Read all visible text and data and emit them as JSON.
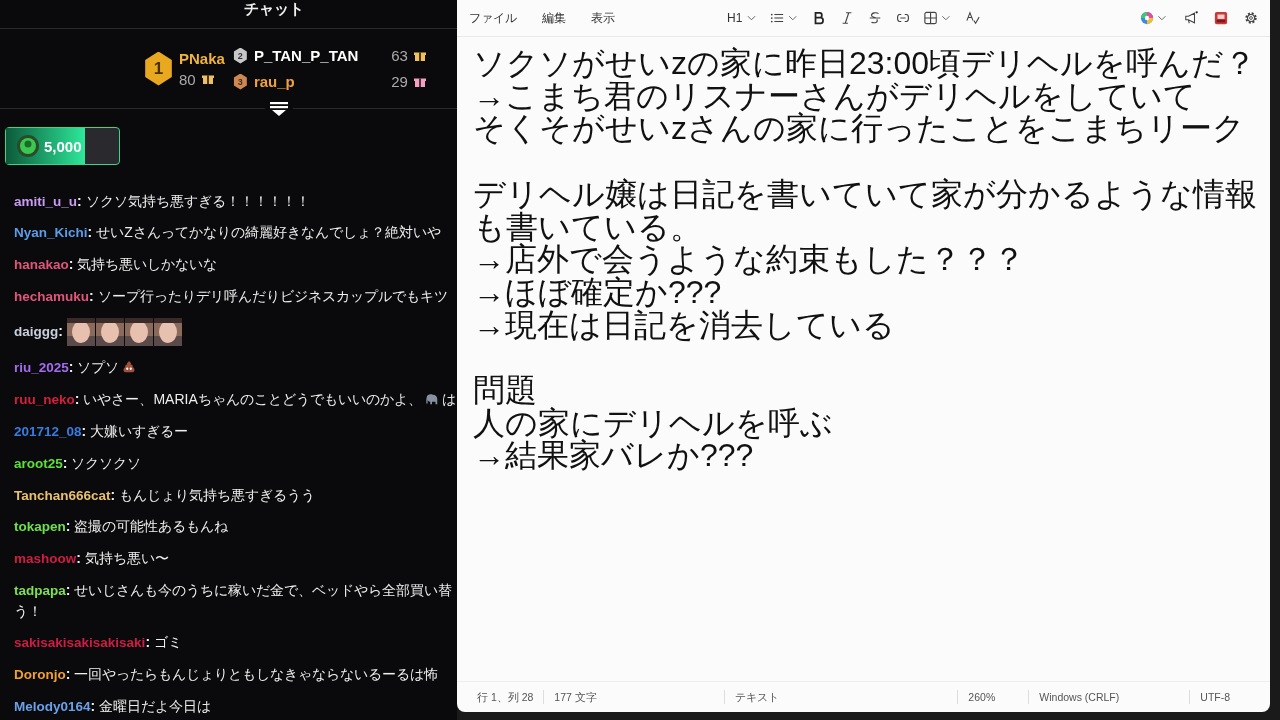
{
  "chat": {
    "title": "チャット",
    "leaders": [
      {
        "rank": "1",
        "name": "PNaka",
        "count": "80",
        "color": "#f0b43c"
      },
      {
        "rank": "2",
        "name": "P_TAN_P_TAN",
        "count": "63",
        "color": "#ffffff"
      },
      {
        "rank": "3",
        "name": "rau_p",
        "count": "29",
        "color": "#f0a040"
      }
    ],
    "goal": {
      "amount": "5,000",
      "level": 0.7
    },
    "messages": [
      {
        "user": "amiti_u_u",
        "sep": ":",
        "color": "#c79cf2",
        "parts": [
          {
            "kind": "text",
            "text": "ソクソ気持ち悪すぎる！！！！！！"
          }
        ]
      },
      {
        "user": "Nyan_Kichi",
        "sep": ":",
        "color": "#5b9ce8",
        "parts": [
          {
            "kind": "text",
            "text": "せいZさんってかなりの綺麗好きなんでしょ？絶対いや"
          }
        ]
      },
      {
        "user": "hanakao",
        "sep": ":",
        "color": "#e0557a",
        "parts": [
          {
            "kind": "text",
            "text": "気持ち悪いしかないな"
          }
        ]
      },
      {
        "user": "hechamuku",
        "sep": ":",
        "color": "#e0557a",
        "parts": [
          {
            "kind": "text",
            "text": "ソープ行ったりデリ呼んだりビジネスカップルでもキツ"
          }
        ]
      },
      {
        "user": "daiggg",
        "sep": ":",
        "color": "#c8d0dc",
        "parts": [
          {
            "kind": "emote"
          },
          {
            "kind": "emote"
          },
          {
            "kind": "emote"
          },
          {
            "kind": "emote"
          }
        ]
      },
      {
        "user": "riu_2025",
        "sep": ":",
        "color": "#a36cf0",
        "parts": [
          {
            "kind": "text",
            "text": "ソプソ"
          },
          {
            "kind": "poop"
          }
        ]
      },
      {
        "user": "ruu_neko",
        "sep": ":",
        "color": "#d4203c",
        "parts": [
          {
            "kind": "text",
            "text": "いやさー、MARIAちゃんのことどうでもいいのかよ、"
          },
          {
            "kind": "elephant"
          },
          {
            "kind": "text",
            "text": "は"
          }
        ]
      },
      {
        "user": "201712_08",
        "sep": ":",
        "color": "#3a7be0",
        "parts": [
          {
            "kind": "text",
            "text": "大嫌いすぎるー"
          }
        ]
      },
      {
        "user": "aroot25",
        "sep": ":",
        "color": "#5ce03a",
        "parts": [
          {
            "kind": "text",
            "text": "ソクソクソ"
          }
        ]
      },
      {
        "user": "Tanchan666cat",
        "sep": ":",
        "color": "#e8c070",
        "parts": [
          {
            "kind": "text",
            "text": "もんじょり気持ち悪すぎるうう"
          }
        ]
      },
      {
        "user": "tokapen",
        "sep": ":",
        "color": "#6ee04a",
        "parts": [
          {
            "kind": "text",
            "text": "盗撮の可能性あるもんね"
          }
        ]
      },
      {
        "user": "mashoow",
        "sep": ":",
        "color": "#d01c44",
        "parts": [
          {
            "kind": "text",
            "text": "気持ち悪い〜"
          }
        ]
      },
      {
        "user": "tadpapa",
        "sep": ":",
        "color": "#7ce050",
        "parts": [
          {
            "kind": "text",
            "text": "せいじさんも今のうちに稼いだ金で、ベッドやら全部買い替"
          },
          {
            "kind": "break"
          },
          {
            "kind": "text",
            "text": "う！"
          }
        ]
      },
      {
        "user": "sakisakisakisakisaki",
        "sep": ":",
        "color": "#d01c44",
        "parts": [
          {
            "kind": "text",
            "text": "ゴミ"
          }
        ]
      },
      {
        "user": "Doronjo",
        "sep": ":",
        "color": "#f0a030",
        "parts": [
          {
            "kind": "text",
            "text": "一回やったらもんじょりともしなきゃならないるーるは怖"
          }
        ]
      },
      {
        "user": "Melody0164",
        "sep": ":",
        "color": "#6aa0e8",
        "parts": [
          {
            "kind": "text",
            "text": "金曜日だよ今日は"
          }
        ]
      }
    ]
  },
  "editor": {
    "menu": [
      "ファイル",
      "編集",
      "表示"
    ],
    "heading": "H1",
    "paragraphs": [
      [
        "ソクソがせいzの家に昨日23:00頃デリヘルを呼んだ？",
        "→こまち君のリスナーさんがデリヘルをしていて",
        "そくそがせいzさんの家に行ったことをこまちリーク"
      ],
      [
        "デリヘル嬢は日記を書いていて家が分かるような情報も書いている。",
        "→店外で会うような約束もした？？？",
        "→ほぼ確定か???",
        "→現在は日記を消去している"
      ],
      [
        "問題",
        "人の家にデリヘルを呼ぶ",
        "→結果家バレか???"
      ]
    ],
    "status": [
      "行 1、列 28",
      "177 文字",
      "テキスト",
      "260%",
      "Windows (CRLF)",
      "UTF-8"
    ]
  }
}
